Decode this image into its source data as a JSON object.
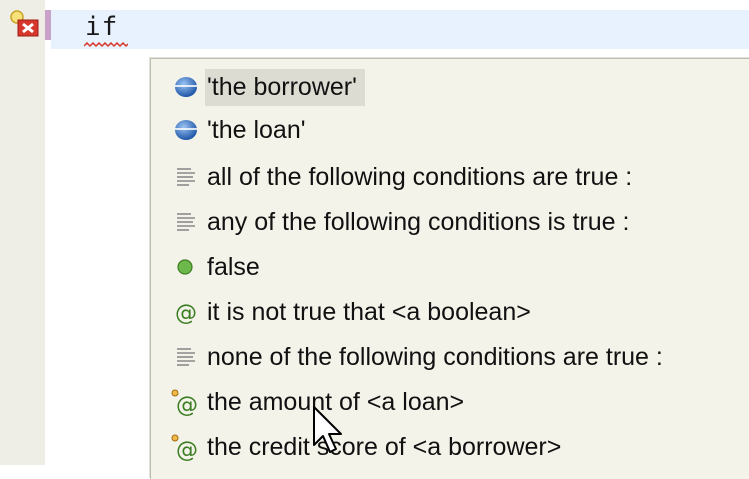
{
  "editor": {
    "code": "if"
  },
  "completion": {
    "items": [
      {
        "label": "'the borrower'",
        "icon": "blue-ball-icon",
        "selected": true
      },
      {
        "label": "'the loan'",
        "icon": "blue-ball-icon",
        "selected": false
      },
      {
        "label": "all of the following conditions are true :",
        "icon": "text-lines-icon",
        "selected": false
      },
      {
        "label": "any of the following conditions is true :",
        "icon": "text-lines-icon",
        "selected": false
      },
      {
        "label": "false",
        "icon": "green-dot-icon",
        "selected": false
      },
      {
        "label": "it is not true that <a boolean>",
        "icon": "at-sign-icon",
        "selected": false
      },
      {
        "label": "none of the following conditions are true :",
        "icon": "text-lines-icon",
        "selected": false
      },
      {
        "label": "the amount of <a loan>",
        "icon": "at-sign-dot-icon",
        "selected": false
      },
      {
        "label": "the credit score of <a borrower>",
        "icon": "at-sign-dot-icon",
        "selected": false
      }
    ]
  },
  "colors": {
    "accent_blue": "#2f6bc2",
    "green": "#5aa53a",
    "error_red": "#d8372c",
    "popup_bg": "#f4f3ea"
  }
}
